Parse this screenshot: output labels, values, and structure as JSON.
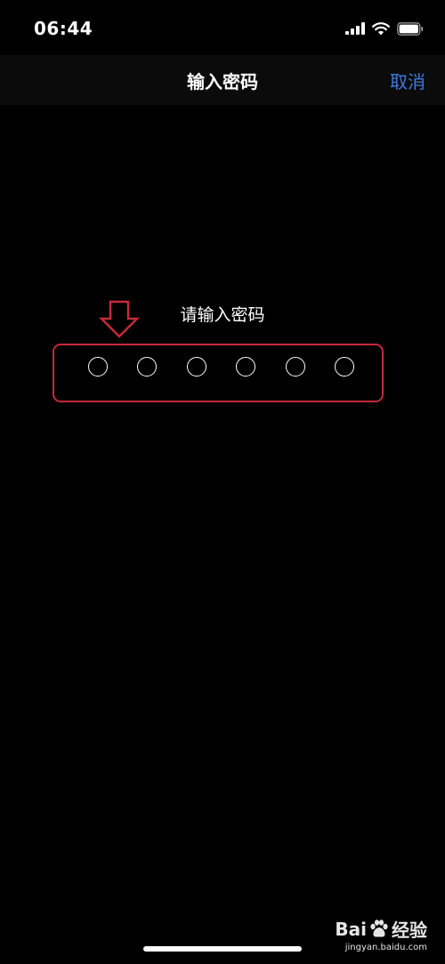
{
  "status_bar": {
    "time": "06:44",
    "icons": [
      "signal-icon",
      "wifi-icon",
      "battery-icon"
    ]
  },
  "nav": {
    "title": "输入密码",
    "cancel_label": "取消"
  },
  "pin": {
    "prompt": "请输入密码",
    "length": 6,
    "entered": 0
  },
  "colors": {
    "background": "#000000",
    "accent": "#3e7be0",
    "annotation": "#c42a3a"
  },
  "watermark": {
    "brand": "Bai",
    "brand_suffix": "经验",
    "url": "jingyan.baidu.com"
  }
}
